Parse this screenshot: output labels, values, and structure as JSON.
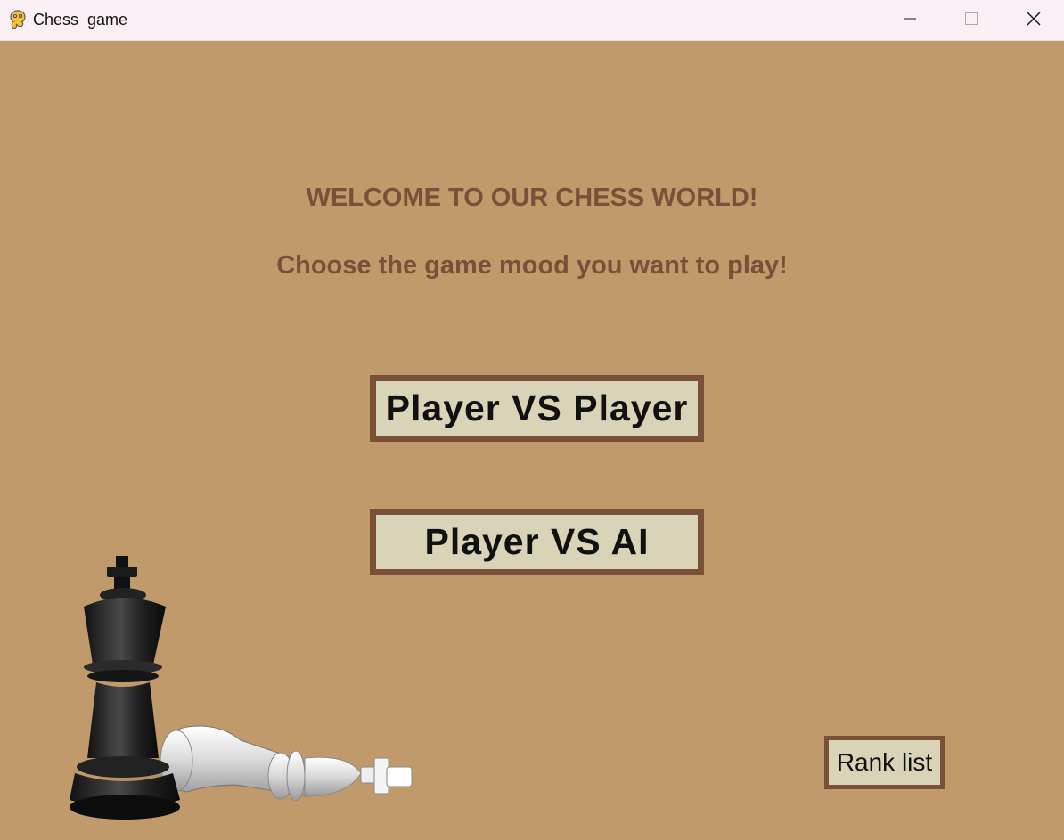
{
  "window": {
    "title": "Chess  game",
    "app_icon": "pygame-snake-icon",
    "controls": [
      "minimize-icon",
      "maximize-icon",
      "close-icon"
    ]
  },
  "menu": {
    "welcome": "WELCOME TO OUR CHESS WORLD!",
    "prompt": "Choose the game mood you want to play!",
    "buttons": {
      "pvp": "Player VS Player",
      "pva": "Player VS AI",
      "rank": "Rank list"
    }
  },
  "colors": {
    "background": "#c19a6b",
    "heading_text": "#7a5038",
    "button_fill": "#d9d4b8",
    "button_border": "#7a5038",
    "button_text": "#111111"
  },
  "decoration": {
    "image": "black-king-and-fallen-white-king-illustration"
  }
}
